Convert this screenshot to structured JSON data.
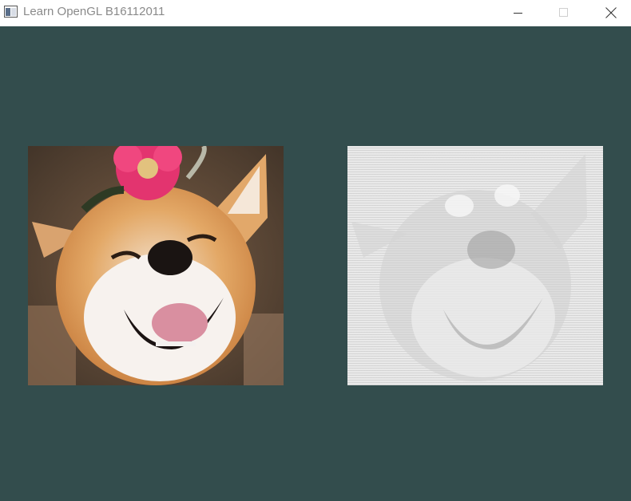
{
  "window": {
    "title": "Learn OpenGL B16112011"
  },
  "titlebar": {
    "icons": {
      "app": "app-window-icon",
      "minimize": "minimize-icon",
      "maximize": "maximize-icon",
      "close": "close-icon"
    }
  },
  "viewport": {
    "background_color": "#334d4d",
    "left_image": {
      "name": "shiba-inu-original-texture"
    },
    "right_image": {
      "name": "shiba-inu-ascii-filtered-texture"
    }
  }
}
